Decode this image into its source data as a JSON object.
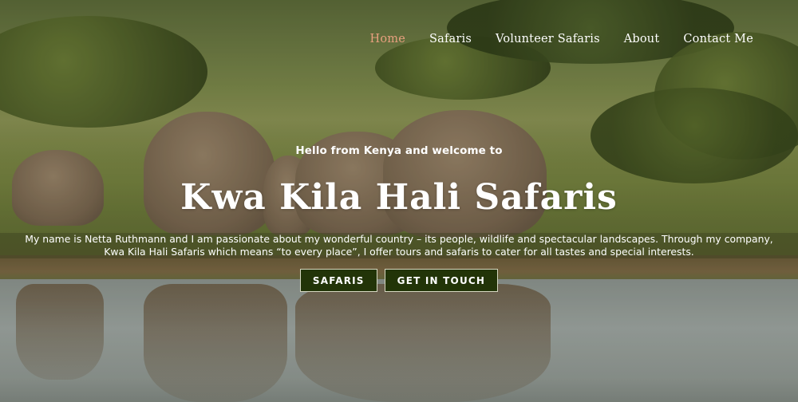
{
  "nav": {
    "items": [
      {
        "label": "Home",
        "active": true
      },
      {
        "label": "Safaris",
        "active": false
      },
      {
        "label": "Volunteer Safaris",
        "active": false
      },
      {
        "label": "About",
        "active": false
      },
      {
        "label": "Contact Me",
        "active": false
      }
    ]
  },
  "hero": {
    "greeting": "Hello from Kenya and welcome to",
    "title": "Kwa Kila Hali Safaris",
    "intro": "My name is Netta Ruthmann and I am passionate about my wonderful country – its people, wildlife and spectacular landscapes. Through my company, Kwa Kila Hali Safaris which means “to every place”, I offer tours and safaris to cater for all tastes and special interests.",
    "buttons": {
      "safaris": "SAFARIS",
      "contact": "GET IN TOUCH"
    }
  },
  "colors": {
    "active_nav": "#e8a07f",
    "button_bg": "#223408",
    "text": "#ffffff"
  }
}
